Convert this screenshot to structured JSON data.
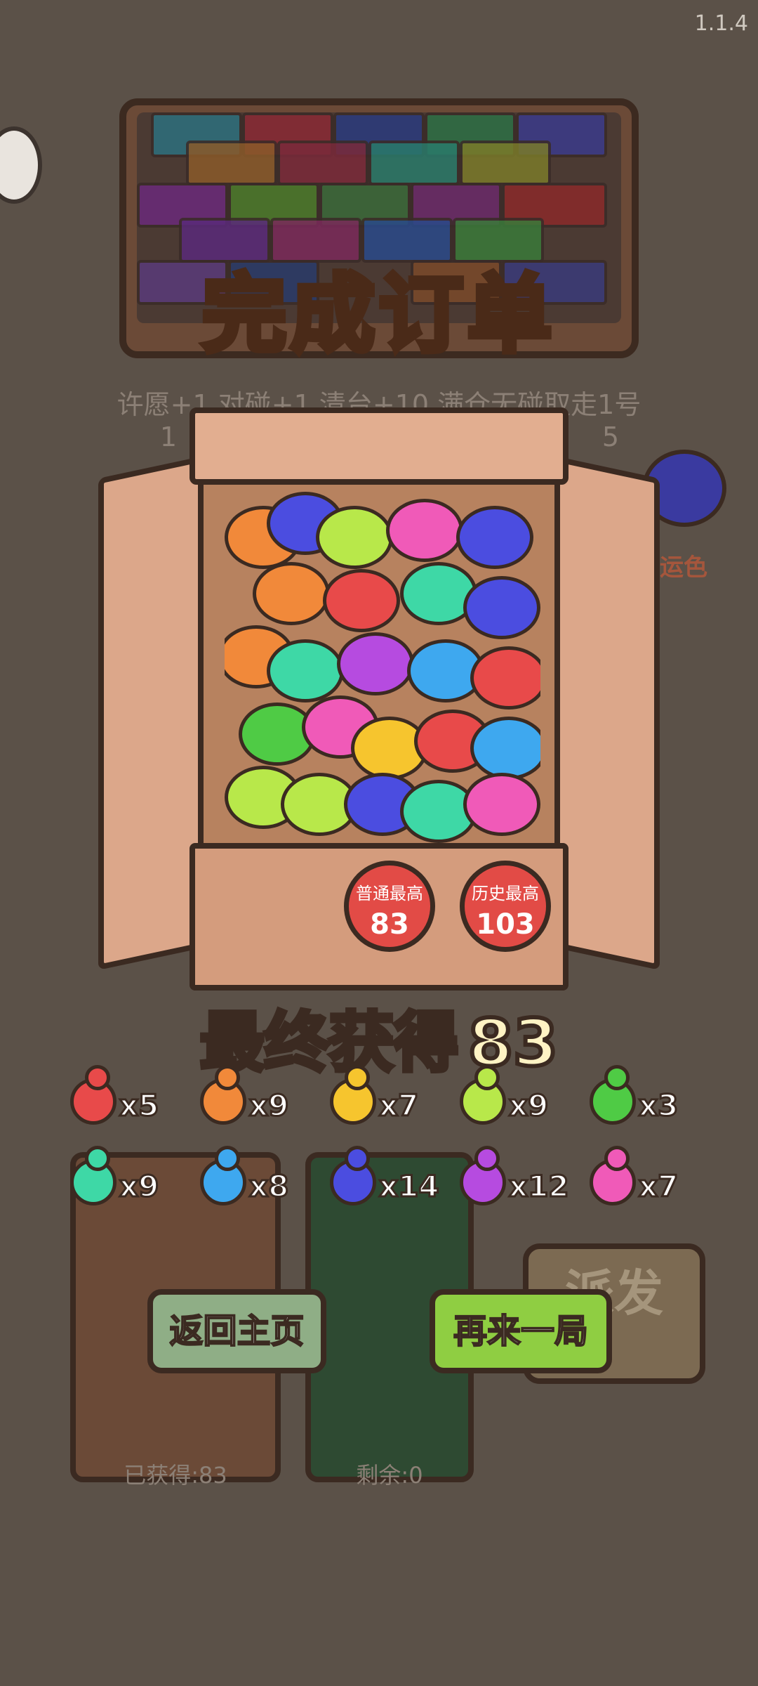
{
  "version": "1.1.4",
  "title": "完成订单",
  "bg_text": {
    "line1": "许愿+1 对碰+1 清台+10 满仓无碰取走1号",
    "line2a": "1",
    "line2b": "5"
  },
  "luck": {
    "label": "运色"
  },
  "box": {
    "normal_best_label": "普通最高",
    "normal_best_value": "83",
    "history_best_label": "历史最高",
    "history_best_value": "103"
  },
  "final": {
    "label": "最终获得",
    "value": "83"
  },
  "turtles": [
    {
      "color": "#e84a4a",
      "count": "x5"
    },
    {
      "color": "#f1893a",
      "count": "x9"
    },
    {
      "color": "#f6c52e",
      "count": "x7"
    },
    {
      "color": "#b8e84a",
      "count": "x9"
    },
    {
      "color": "#4fcb45",
      "count": "x3"
    },
    {
      "color": "#3ed8a6",
      "count": "x9"
    },
    {
      "color": "#3ea8ef",
      "count": "x8"
    },
    {
      "color": "#4b4de0",
      "count": "x14"
    },
    {
      "color": "#b64be0",
      "count": "x12"
    },
    {
      "color": "#f05ab8",
      "count": "x7"
    }
  ],
  "bins": {
    "left_label": "已获得:83",
    "right_label": "剩余:0"
  },
  "buttons": {
    "home": "返回主页",
    "again": "再来一局",
    "send": "派发"
  },
  "colors": {
    "home_button": "#8fae86",
    "again_button": "#8fce42",
    "title": "#ffd167",
    "final_label": "#8ed060"
  }
}
